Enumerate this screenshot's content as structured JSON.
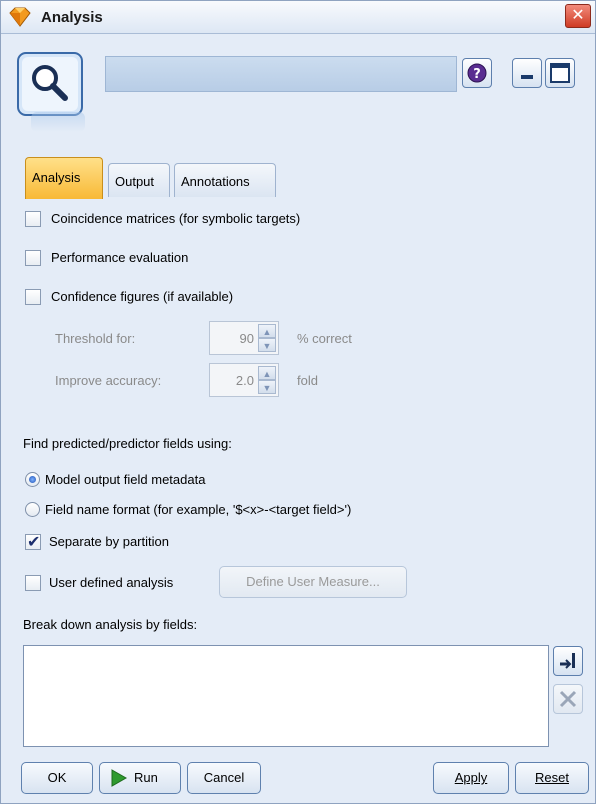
{
  "window": {
    "title": "Analysis",
    "close_glyph": "✕",
    "icon": "diamond-node-icon"
  },
  "header": {
    "node_icon": "magnifier-icon",
    "name_value": "",
    "help_icon": "help-icon",
    "minimize_icon": "minimize-icon",
    "maximize_icon": "maximize-icon"
  },
  "tabs": [
    {
      "label": "Analysis",
      "active": true
    },
    {
      "label": "Output",
      "active": false
    },
    {
      "label": "Annotations",
      "active": false
    }
  ],
  "options": {
    "coincidence": {
      "label": "Coincidence matrices (for symbolic targets)",
      "checked": false
    },
    "performance": {
      "label": "Performance evaluation",
      "checked": false
    },
    "confidence": {
      "label": "Confidence figures (if available)",
      "checked": false
    },
    "threshold": {
      "label": "Threshold for:",
      "value": "90",
      "suffix": "% correct"
    },
    "improve": {
      "label": "Improve accuracy:",
      "value": "2.0",
      "suffix": "fold"
    },
    "find_label": "Find predicted/predictor fields using:",
    "radio_model": {
      "label": "Model output field metadata",
      "selected": true
    },
    "radio_format": {
      "label": "Field name format (for example, '$<x>-<target field>')",
      "selected": false
    },
    "separate": {
      "label": "Separate by partition",
      "checked": true
    },
    "user_defined": {
      "label": "User defined analysis",
      "checked": false
    },
    "define_button": "Define User Measure...",
    "breakdown_label": "Break down analysis by fields:",
    "breakdown_fields": []
  },
  "footer": {
    "ok": "OK",
    "run": "Run",
    "cancel": "Cancel",
    "apply": "Apply",
    "reset": "Reset"
  },
  "colors": {
    "active_tab": "#f8b936",
    "window_bg": "#e4ecf7",
    "run_arrow": "#2f9a2f",
    "close_red": "#cf3b24"
  }
}
